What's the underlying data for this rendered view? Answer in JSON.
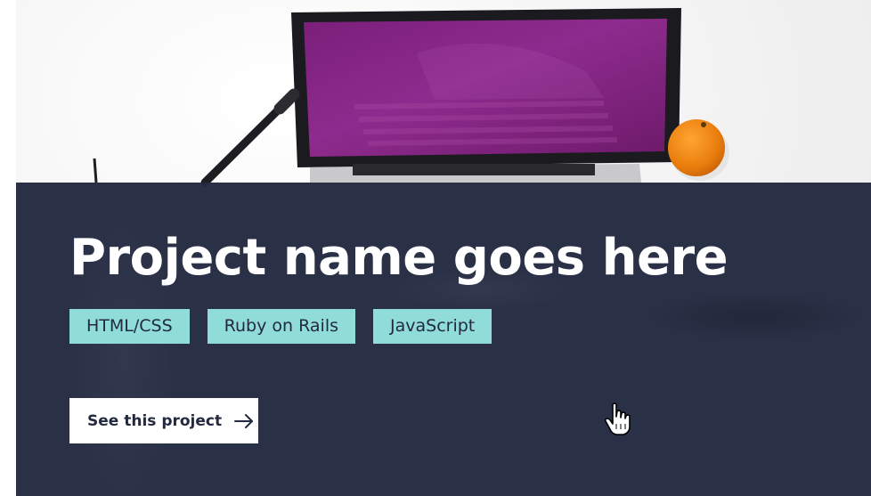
{
  "project": {
    "title": "Project name goes here",
    "tags": [
      "HTML/CSS",
      "Ruby on Rails",
      "JavaScript"
    ],
    "cta_label": "See this project",
    "cta_icon": "arrow-right-icon"
  },
  "image": {
    "description_icon": "laptop-desk-photo"
  },
  "colors": {
    "overlay": "#232940",
    "tag_background": "#8fdcd8",
    "title_text": "#ffffff",
    "button_background": "#ffffff"
  }
}
